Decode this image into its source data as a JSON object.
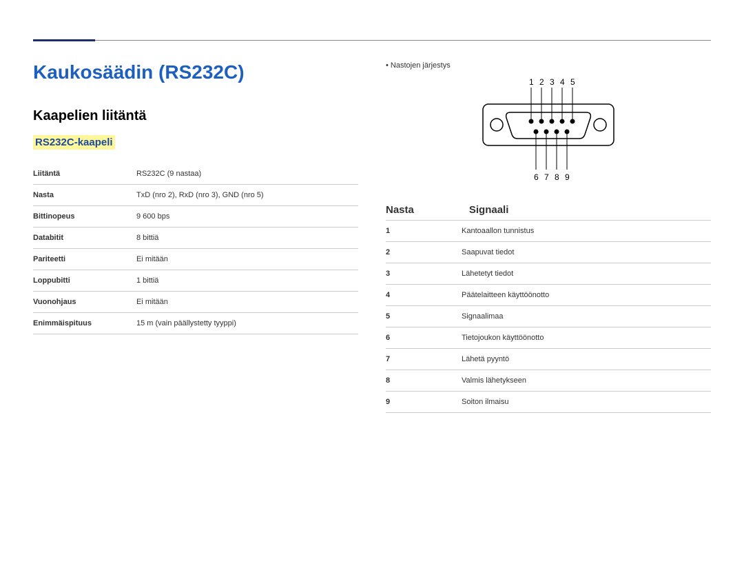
{
  "title": "Kaukosäädin (RS232C)",
  "section_heading": "Kaapelien liitäntä",
  "subheading": "RS232C-kaapeli",
  "spec_rows": [
    {
      "label": "Liitäntä",
      "value": "RS232C (9 nastaa)"
    },
    {
      "label": "Nasta",
      "value": "TxD (nro 2), RxD (nro 3), GND (nro 5)"
    },
    {
      "label": "Bittinopeus",
      "value": "9 600 bps"
    },
    {
      "label": "Databitit",
      "value": "8 bittiä"
    },
    {
      "label": "Pariteetti",
      "value": "Ei mitään"
    },
    {
      "label": "Loppubitti",
      "value": "1 bittiä"
    },
    {
      "label": "Vuonohjaus",
      "value": "Ei mitään"
    },
    {
      "label": "Enimmäispituus",
      "value": "15 m (vain päällystetty tyyppi)"
    }
  ],
  "pin_order_label": "Nastojen järjestys",
  "top_pins": [
    "1",
    "2",
    "3",
    "4",
    "5"
  ],
  "bottom_pins": [
    "6",
    "7",
    "8",
    "9"
  ],
  "signal_header": {
    "pin": "Nasta",
    "signal": "Signaali"
  },
  "signals": [
    {
      "pin": "1",
      "signal": "Kantoaallon tunnistus"
    },
    {
      "pin": "2",
      "signal": "Saapuvat tiedot"
    },
    {
      "pin": "3",
      "signal": "Lähetetyt tiedot"
    },
    {
      "pin": "4",
      "signal": "Päätelaitteen käyttöönotto"
    },
    {
      "pin": "5",
      "signal": "Signaalimaa"
    },
    {
      "pin": "6",
      "signal": "Tietojoukon käyttöönotto"
    },
    {
      "pin": "7",
      "signal": "Lähetä pyyntö"
    },
    {
      "pin": "8",
      "signal": "Valmis lähetykseen"
    },
    {
      "pin": "9",
      "signal": "Soiton ilmaisu"
    }
  ]
}
